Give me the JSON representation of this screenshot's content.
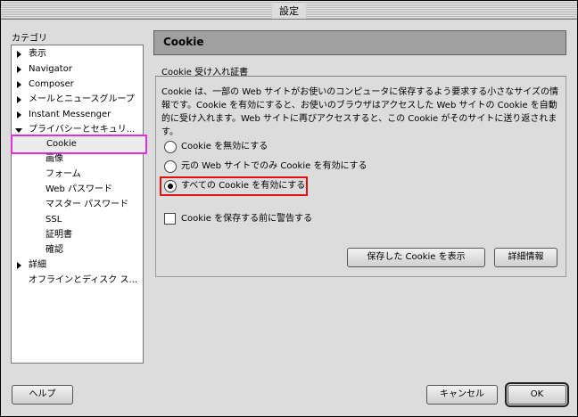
{
  "window": {
    "title": "設定"
  },
  "sidebar": {
    "label": "カテゴリ",
    "items": [
      {
        "label": "表示"
      },
      {
        "label": "Navigator"
      },
      {
        "label": "Composer"
      },
      {
        "label": "メールとニュースグループ"
      },
      {
        "label": "Instant Messenger"
      },
      {
        "label": "プライバシーとセキュリ..."
      },
      {
        "label": "Cookie"
      },
      {
        "label": "画像"
      },
      {
        "label": "フォーム"
      },
      {
        "label": "Web パスワード"
      },
      {
        "label": "マスター パスワード"
      },
      {
        "label": "SSL"
      },
      {
        "label": "証明書"
      },
      {
        "label": "確認"
      },
      {
        "label": "詳細"
      },
      {
        "label": "オフラインとディスク ス..."
      }
    ]
  },
  "panel": {
    "title": "Cookie",
    "group_label": "Cookie 受け入れ証書",
    "description": "Cookie は、一部の Web サイトがお使いのコンピュータに保存するよう要求する小さなサイズの情報です。Cookie を有効にすると、お使いのブラウザはアクセスした Web サイトの Cookie を自動的に受け入れます。Web サイトに再びアクセスすると、この Cookie がそのサイトに送り返されます。",
    "options": [
      {
        "label": "Cookie を無効にする"
      },
      {
        "label": "元の Web サイトでのみ Cookie を有効にする"
      },
      {
        "label": "すべての Cookie を有効にする"
      }
    ],
    "warn_label": "Cookie を保存する前に警告する",
    "show_cookies_label": "保存した Cookie を表示",
    "details_label": "詳細情報"
  },
  "footer": {
    "help_label": "ヘルプ",
    "cancel_label": "キャンセル",
    "ok_label": "OK"
  }
}
